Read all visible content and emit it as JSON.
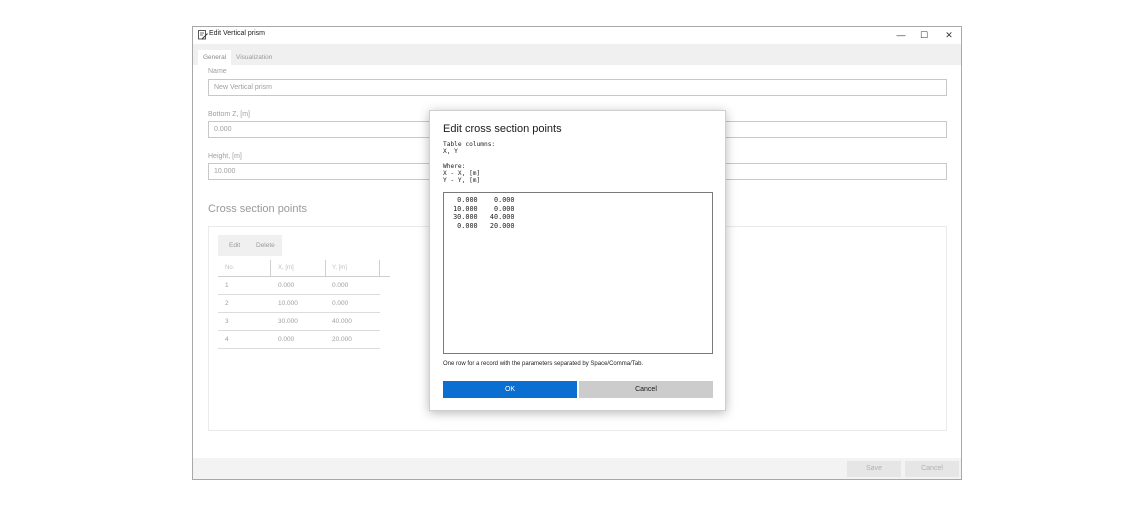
{
  "window": {
    "title": "Edit Vertical prism",
    "minimize": "—",
    "maximize": "☐",
    "close": "✕"
  },
  "tabs": [
    {
      "label": "General"
    },
    {
      "label": "Visualization"
    }
  ],
  "fields": {
    "name_label": "Name",
    "name_value": "New Vertical prism",
    "bottom_label": "Bottom Z, [m]",
    "bottom_value": "0.000",
    "height_label": "Height, [m]",
    "height_value": "10.000"
  },
  "cross_section": {
    "title": "Cross section points",
    "edit_label": "Edit",
    "delete_label": "Delete",
    "columns": [
      "No.",
      "X, [m]",
      "Y, [m]"
    ],
    "rows": [
      {
        "no": "1",
        "x": "0.000",
        "y": "0.000"
      },
      {
        "no": "2",
        "x": "10.000",
        "y": "0.000"
      },
      {
        "no": "3",
        "x": "30.000",
        "y": "40.000"
      },
      {
        "no": "4",
        "x": "0.000",
        "y": "20.000"
      }
    ]
  },
  "footer": {
    "save_label": "Save",
    "cancel_label": "Cancel"
  },
  "dialog": {
    "title": "Edit cross section points",
    "table_columns_label": "Table columns:",
    "table_columns_value": "X, Y",
    "where_label": "Where:",
    "where_x": "X - X, [m]",
    "where_y": "Y - Y, [m]",
    "text_content": "  0.000    0.000\n 10.000    0.000\n 30.000   40.000\n  0.000   20.000",
    "hint": "One row for a record with the parameters separated by Space/Comma/Tab.",
    "ok_label": "OK",
    "cancel_label": "Cancel"
  },
  "colors": {
    "accent": "#0a6fd1",
    "secondary_button": "#cccccc"
  }
}
